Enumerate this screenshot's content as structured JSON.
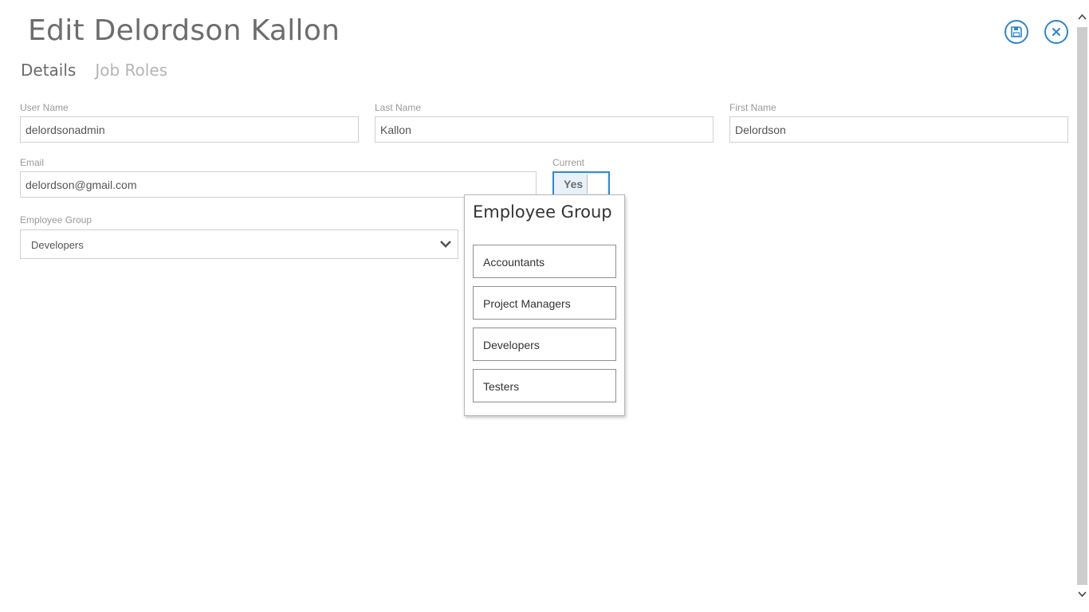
{
  "header": {
    "title": "Edit Delordson Kallon",
    "save_icon": "save-icon",
    "close_icon": "close-icon",
    "accent": "#2f86c7"
  },
  "tabs": [
    {
      "label": "Details",
      "active": true
    },
    {
      "label": "Job Roles",
      "active": false
    }
  ],
  "form": {
    "username": {
      "label": "User Name",
      "value": "delordsonadmin"
    },
    "last_name": {
      "label": "Last Name",
      "value": "Kallon"
    },
    "first_name": {
      "label": "First Name",
      "value": "Delordson"
    },
    "email": {
      "label": "Email",
      "value": "delordson@gmail.com"
    },
    "current": {
      "label": "Current",
      "value": "Yes"
    },
    "employee_group": {
      "label": "Employee Group",
      "value": "Developers"
    }
  },
  "popup": {
    "title": "Employee Group",
    "options": [
      "Accountants",
      "Project Managers",
      "Developers",
      "Testers"
    ]
  }
}
